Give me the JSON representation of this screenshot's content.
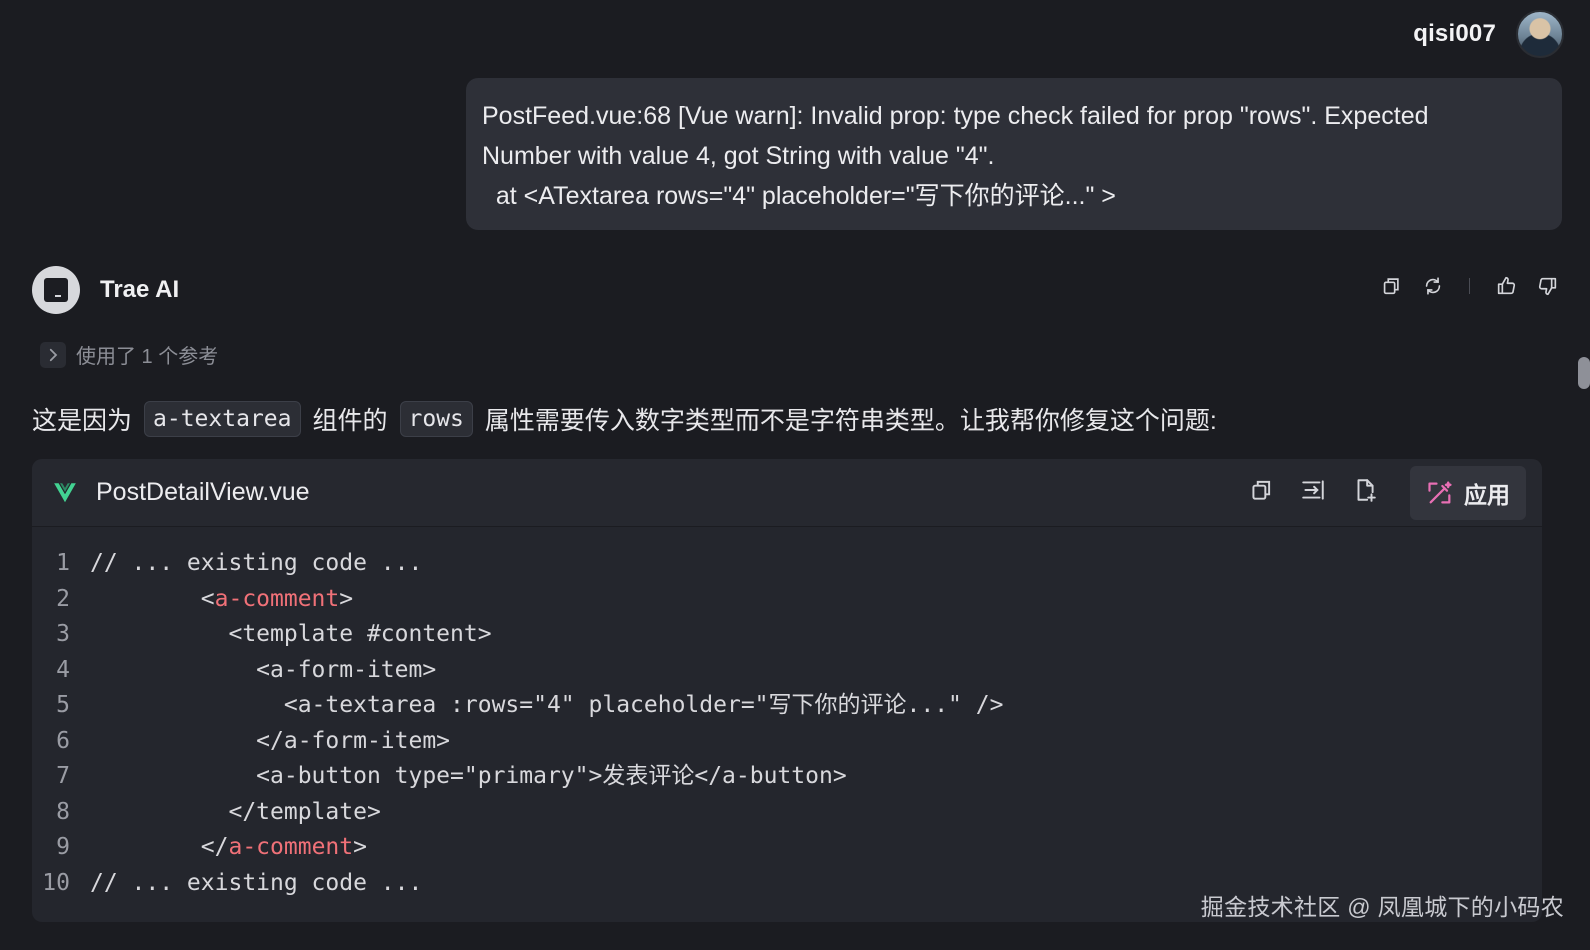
{
  "user": {
    "name": "qisi007",
    "message_lines": [
      "PostFeed.vue:68 [Vue warn]: Invalid prop: type check failed for prop \"rows\". Expected",
      "Number with value 4, got String with value \"4\".",
      "  at <ATextarea rows=\"4\" placeholder=\"写下你的评论...\" >"
    ]
  },
  "assistant": {
    "name": "Trae AI",
    "references_label": "使用了 1 个参考",
    "explanation": {
      "part1": "这是因为",
      "code1": "a-textarea",
      "part2": "组件的",
      "code2": "rows",
      "part3": "属性需要传入数字类型而不是字符串类型。让我帮你修复这个问题:"
    },
    "actions": [
      "copy-icon",
      "regenerate-icon",
      "thumbs-up-icon",
      "thumbs-down-icon"
    ]
  },
  "code_block": {
    "file_name": "PostDetailView.vue",
    "apply_label": "应用",
    "lines": [
      {
        "n": "1",
        "pre": "// ... existing code ...",
        "tag": "",
        "post": ""
      },
      {
        "n": "2",
        "pre": "        <",
        "tag": "a-comment",
        "post": ">"
      },
      {
        "n": "3",
        "pre": "          <template #content>",
        "tag": "",
        "post": ""
      },
      {
        "n": "4",
        "pre": "            <a-form-item>",
        "tag": "",
        "post": ""
      },
      {
        "n": "5",
        "pre": "              <a-textarea :rows=\"4\" placeholder=\"写下你的评论...\" />",
        "tag": "",
        "post": ""
      },
      {
        "n": "6",
        "pre": "            </a-form-item>",
        "tag": "",
        "post": ""
      },
      {
        "n": "7",
        "pre": "            <a-button type=\"primary\">发表评论</a-button>",
        "tag": "",
        "post": ""
      },
      {
        "n": "8",
        "pre": "          </template>",
        "tag": "",
        "post": ""
      },
      {
        "n": "9",
        "pre": "        </",
        "tag": "a-comment",
        "post": ">"
      },
      {
        "n": "10",
        "pre": "// ... existing code ...",
        "tag": "",
        "post": ""
      }
    ]
  },
  "watermark": "掘金技术社区 @ 凤凰城下的小码农",
  "colors": {
    "background": "#1b1c21",
    "bubble": "#2e3038",
    "code_bg": "#24262d",
    "tag_red": "#f07178",
    "vue_green": "#42d392",
    "apply_pink": "#e86fb4"
  }
}
